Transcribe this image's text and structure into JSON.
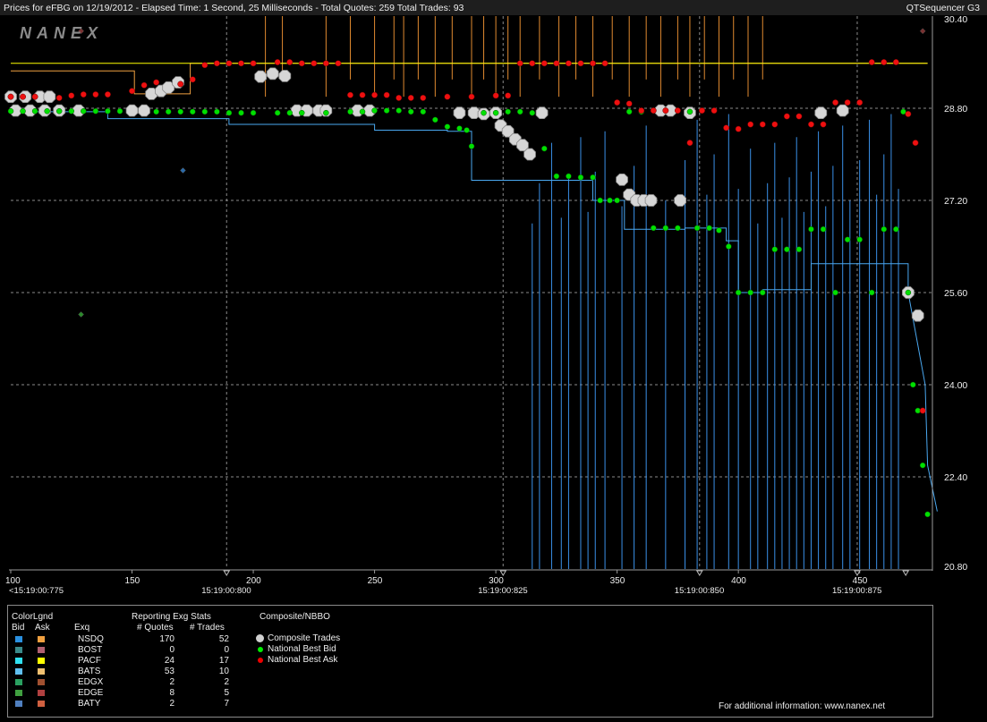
{
  "header": {
    "title": "Prices for  eFBG  on 12/19/2012  -  Elapsed Time: 1 Second, 25 Milliseconds  -  Total Quotes: 259  Total Trades: 93",
    "app_name": "QTSequencer G3"
  },
  "brand": {
    "logo_text": "NANEX"
  },
  "chart_data": {
    "type": "line",
    "title": "",
    "xlabel": "",
    "ylabel": "",
    "xlim": [
      100,
      480
    ],
    "ylim": [
      20.8,
      30.4
    ],
    "x_ticks": [
      100,
      150,
      200,
      250,
      300,
      350,
      400,
      450
    ],
    "y_ticks": [
      "30.40",
      "28.80",
      "27.20",
      "25.60",
      "24.00",
      "22.40",
      "20.80"
    ],
    "time_labels": [
      {
        "x": 100,
        "label": "<15:19:00:775"
      },
      {
        "x": 189,
        "label": "15:19:00:800"
      },
      {
        "x": 303,
        "label": "15:19:00:825"
      },
      {
        "x": 384,
        "label": "15:19:00:850"
      },
      {
        "x": 449,
        "label": "15:19:00:875"
      }
    ],
    "time_markers": [
      189,
      303,
      384,
      449,
      469
    ],
    "series": [
      {
        "name": "NSDQ Ask",
        "color": "#f0a040",
        "values": [
          [
            100,
            29.45
          ],
          [
            151,
            29.45
          ],
          [
            151,
            29.05
          ],
          [
            174,
            29.05
          ],
          [
            174,
            29.58
          ],
          [
            205,
            29.58
          ],
          [
            205,
            29.58
          ],
          [
            370,
            29.58
          ],
          [
            478,
            29.58
          ]
        ]
      },
      {
        "name": "PACF Ask",
        "color": "#ffff00",
        "values": [
          [
            100,
            29.58
          ],
          [
            478,
            29.58
          ]
        ]
      },
      {
        "name": "NSDQ Bid",
        "color": "#4aa8f0",
        "values": [
          [
            100,
            28.74
          ],
          [
            140,
            28.74
          ],
          [
            140,
            28.62
          ],
          [
            190,
            28.62
          ],
          [
            190,
            28.52
          ],
          [
            250,
            28.52
          ],
          [
            250,
            28.42
          ],
          [
            280,
            28.42
          ],
          [
            280,
            28.4
          ],
          [
            290,
            28.4
          ],
          [
            290,
            27.55
          ],
          [
            320,
            27.55
          ],
          [
            320,
            27.55
          ],
          [
            340,
            27.55
          ],
          [
            340,
            27.2
          ],
          [
            353,
            27.2
          ],
          [
            353,
            26.7
          ],
          [
            378,
            26.7
          ],
          [
            378,
            26.72
          ],
          [
            395,
            26.72
          ],
          [
            395,
            26.5
          ],
          [
            400,
            26.5
          ],
          [
            400,
            25.6
          ],
          [
            410,
            25.6
          ],
          [
            410,
            25.65
          ],
          [
            430,
            25.65
          ],
          [
            430,
            26.1
          ],
          [
            470,
            26.1
          ],
          [
            470,
            25.6
          ],
          [
            477,
            24.0
          ],
          [
            478,
            22.6
          ],
          [
            482,
            21.8
          ]
        ]
      }
    ],
    "national_best_bid": [
      [
        100,
        28.75
      ],
      [
        105,
        28.75
      ],
      [
        110,
        28.75
      ],
      [
        115,
        28.75
      ],
      [
        120,
        28.75
      ],
      [
        125,
        28.75
      ],
      [
        130,
        28.75
      ],
      [
        135,
        28.75
      ],
      [
        140,
        28.75
      ],
      [
        145,
        28.75
      ],
      [
        160,
        28.74
      ],
      [
        165,
        28.74
      ],
      [
        170,
        28.74
      ],
      [
        175,
        28.74
      ],
      [
        180,
        28.74
      ],
      [
        185,
        28.74
      ],
      [
        190,
        28.72
      ],
      [
        195,
        28.72
      ],
      [
        200,
        28.72
      ],
      [
        210,
        28.72
      ],
      [
        215,
        28.72
      ],
      [
        220,
        28.72
      ],
      [
        230,
        28.72
      ],
      [
        240,
        28.74
      ],
      [
        245,
        28.74
      ],
      [
        250,
        28.76
      ],
      [
        255,
        28.76
      ],
      [
        260,
        28.76
      ],
      [
        265,
        28.74
      ],
      [
        270,
        28.74
      ],
      [
        275,
        28.6
      ],
      [
        280,
        28.48
      ],
      [
        285,
        28.45
      ],
      [
        288,
        28.42
      ],
      [
        290,
        28.14
      ],
      [
        295,
        28.72
      ],
      [
        300,
        28.72
      ],
      [
        305,
        28.74
      ],
      [
        310,
        28.74
      ],
      [
        315,
        28.72
      ],
      [
        320,
        28.1
      ],
      [
        325,
        27.62
      ],
      [
        330,
        27.62
      ],
      [
        335,
        27.6
      ],
      [
        340,
        27.6
      ],
      [
        343,
        27.2
      ],
      [
        347,
        27.2
      ],
      [
        350,
        27.2
      ],
      [
        355,
        28.74
      ],
      [
        360,
        28.74
      ],
      [
        365,
        26.72
      ],
      [
        370,
        26.72
      ],
      [
        375,
        26.72
      ],
      [
        380,
        28.74
      ],
      [
        383,
        26.72
      ],
      [
        388,
        26.72
      ],
      [
        392,
        26.68
      ],
      [
        396,
        26.4
      ],
      [
        400,
        25.6
      ],
      [
        405,
        25.6
      ],
      [
        410,
        25.6
      ],
      [
        415,
        26.35
      ],
      [
        420,
        26.35
      ],
      [
        425,
        26.35
      ],
      [
        430,
        26.7
      ],
      [
        435,
        26.7
      ],
      [
        440,
        25.6
      ],
      [
        445,
        26.52
      ],
      [
        450,
        26.52
      ],
      [
        455,
        25.6
      ],
      [
        460,
        26.7
      ],
      [
        465,
        26.7
      ],
      [
        468,
        28.74
      ],
      [
        470,
        25.6
      ],
      [
        472,
        24.0
      ],
      [
        474,
        23.55
      ],
      [
        476,
        22.6
      ],
      [
        478,
        21.75
      ]
    ],
    "national_best_ask": [
      [
        100,
        29.0
      ],
      [
        105,
        29.0
      ],
      [
        110,
        29.0
      ],
      [
        120,
        28.98
      ],
      [
        125,
        29.02
      ],
      [
        130,
        29.04
      ],
      [
        135,
        29.04
      ],
      [
        140,
        29.04
      ],
      [
        150,
        29.1
      ],
      [
        155,
        29.2
      ],
      [
        160,
        29.25
      ],
      [
        170,
        29.22
      ],
      [
        175,
        29.3
      ],
      [
        180,
        29.55
      ],
      [
        185,
        29.58
      ],
      [
        190,
        29.58
      ],
      [
        195,
        29.58
      ],
      [
        200,
        29.58
      ],
      [
        210,
        29.6
      ],
      [
        215,
        29.6
      ],
      [
        220,
        29.58
      ],
      [
        225,
        29.58
      ],
      [
        230,
        29.58
      ],
      [
        235,
        29.58
      ],
      [
        240,
        29.03
      ],
      [
        245,
        29.03
      ],
      [
        250,
        29.03
      ],
      [
        255,
        29.03
      ],
      [
        260,
        28.98
      ],
      [
        265,
        28.98
      ],
      [
        270,
        28.98
      ],
      [
        280,
        29.0
      ],
      [
        290,
        29.0
      ],
      [
        300,
        29.02
      ],
      [
        305,
        29.02
      ],
      [
        310,
        29.58
      ],
      [
        315,
        29.58
      ],
      [
        320,
        29.58
      ],
      [
        325,
        29.58
      ],
      [
        330,
        29.58
      ],
      [
        335,
        29.58
      ],
      [
        340,
        29.58
      ],
      [
        345,
        29.58
      ],
      [
        350,
        28.9
      ],
      [
        355,
        28.88
      ],
      [
        360,
        28.76
      ],
      [
        365,
        28.76
      ],
      [
        370,
        28.76
      ],
      [
        375,
        28.76
      ],
      [
        380,
        28.2
      ],
      [
        385,
        28.76
      ],
      [
        390,
        28.76
      ],
      [
        395,
        28.46
      ],
      [
        400,
        28.44
      ],
      [
        405,
        28.52
      ],
      [
        410,
        28.52
      ],
      [
        415,
        28.52
      ],
      [
        420,
        28.66
      ],
      [
        425,
        28.66
      ],
      [
        430,
        28.52
      ],
      [
        435,
        28.52
      ],
      [
        440,
        28.9
      ],
      [
        445,
        28.9
      ],
      [
        450,
        28.9
      ],
      [
        455,
        29.6
      ],
      [
        460,
        29.6
      ],
      [
        465,
        29.6
      ],
      [
        470,
        28.7
      ],
      [
        473,
        28.2
      ],
      [
        476,
        23.55
      ]
    ],
    "composite_trades": [
      [
        100,
        29.0
      ],
      [
        106,
        29.0
      ],
      [
        112,
        29.0
      ],
      [
        116,
        29.0
      ],
      [
        102,
        28.76
      ],
      [
        108,
        28.76
      ],
      [
        114,
        28.76
      ],
      [
        120,
        28.76
      ],
      [
        128,
        28.76
      ],
      [
        150,
        28.76
      ],
      [
        155,
        28.76
      ],
      [
        158,
        29.05
      ],
      [
        162,
        29.1
      ],
      [
        165,
        29.16
      ],
      [
        169,
        29.25
      ],
      [
        203,
        29.35
      ],
      [
        208,
        29.4
      ],
      [
        213,
        29.36
      ],
      [
        218,
        28.76
      ],
      [
        222,
        28.76
      ],
      [
        227,
        28.76
      ],
      [
        230,
        28.76
      ],
      [
        243,
        28.76
      ],
      [
        248,
        28.76
      ],
      [
        285,
        28.72
      ],
      [
        291,
        28.72
      ],
      [
        295,
        28.7
      ],
      [
        300,
        28.72
      ],
      [
        302,
        28.5
      ],
      [
        305,
        28.4
      ],
      [
        308,
        28.26
      ],
      [
        311,
        28.16
      ],
      [
        314,
        28.0
      ],
      [
        319,
        28.72
      ],
      [
        352,
        27.56
      ],
      [
        355,
        27.3
      ],
      [
        358,
        27.2
      ],
      [
        361,
        27.2
      ],
      [
        364,
        27.2
      ],
      [
        368,
        28.76
      ],
      [
        372,
        28.76
      ],
      [
        376,
        27.2
      ],
      [
        380,
        28.72
      ],
      [
        434,
        28.72
      ],
      [
        443,
        28.76
      ],
      [
        470,
        25.6
      ],
      [
        474,
        25.2
      ]
    ],
    "stray_marks": [
      {
        "x": 129,
        "y": 30.14,
        "color": "#7a3030"
      },
      {
        "x": 171,
        "y": 27.72,
        "color": "#2a6aa8"
      },
      {
        "x": 129,
        "y": 25.22,
        "color": "#2a8a2a"
      },
      {
        "x": 476,
        "y": 30.14,
        "color": "#7a3030"
      }
    ],
    "blue_spikes": [
      315,
      318,
      323,
      327,
      330,
      335,
      338,
      341,
      345,
      352,
      357,
      362,
      370,
      378,
      383,
      387,
      390,
      396,
      400,
      405,
      408,
      412,
      415,
      418,
      421,
      424,
      427,
      430,
      433,
      436,
      439,
      443,
      446,
      450,
      454,
      457,
      460,
      463,
      466
    ],
    "orange_spikes": [
      205,
      212,
      230,
      240,
      250,
      258,
      262,
      268,
      275,
      282,
      290,
      295,
      300,
      305,
      310,
      318,
      326,
      333,
      340,
      348,
      355,
      362,
      368,
      375,
      380,
      386,
      392,
      398,
      404,
      410
    ]
  },
  "legend": {
    "color_legend_title": "ColorLgnd",
    "bid_label": "Bid",
    "ask_label": "Ask",
    "exq_label": "Exq",
    "stats_title": "Reporting Exg Stats",
    "quotes_col": "# Quotes",
    "trades_col": "# Trades",
    "composite_title": "Composite/NBBO",
    "rows": [
      {
        "exq": "NSDQ",
        "bid_color": "#2a90e0",
        "ask_color": "#f0a040",
        "quotes": "170",
        "trades": "52"
      },
      {
        "exq": "BOST",
        "bid_color": "#3a8a8a",
        "ask_color": "#b06070",
        "quotes": "0",
        "trades": "0"
      },
      {
        "exq": "PACF",
        "bid_color": "#30e0f0",
        "ask_color": "#ffff00",
        "quotes": "24",
        "trades": "17"
      },
      {
        "exq": "BATS",
        "bid_color": "#60c0f0",
        "ask_color": "#f0c070",
        "quotes": "53",
        "trades": "10"
      },
      {
        "exq": "EDGX",
        "bid_color": "#2aa060",
        "ask_color": "#a05030",
        "quotes": "2",
        "trades": "2"
      },
      {
        "exq": "EDGE",
        "bid_color": "#40a040",
        "ask_color": "#b04040",
        "quotes": "8",
        "trades": "5"
      },
      {
        "exq": "BATY",
        "bid_color": "#5080c0",
        "ask_color": "#d06040",
        "quotes": "2",
        "trades": "7"
      }
    ],
    "composite_items": [
      {
        "label": "Composite Trades",
        "color": "#d0d0d0"
      },
      {
        "label": "National Best Bid",
        "color": "#00ee00"
      },
      {
        "label": "National Best Ask",
        "color": "#ee0000"
      }
    ],
    "footer": "For additional information: www.nanex.net"
  }
}
